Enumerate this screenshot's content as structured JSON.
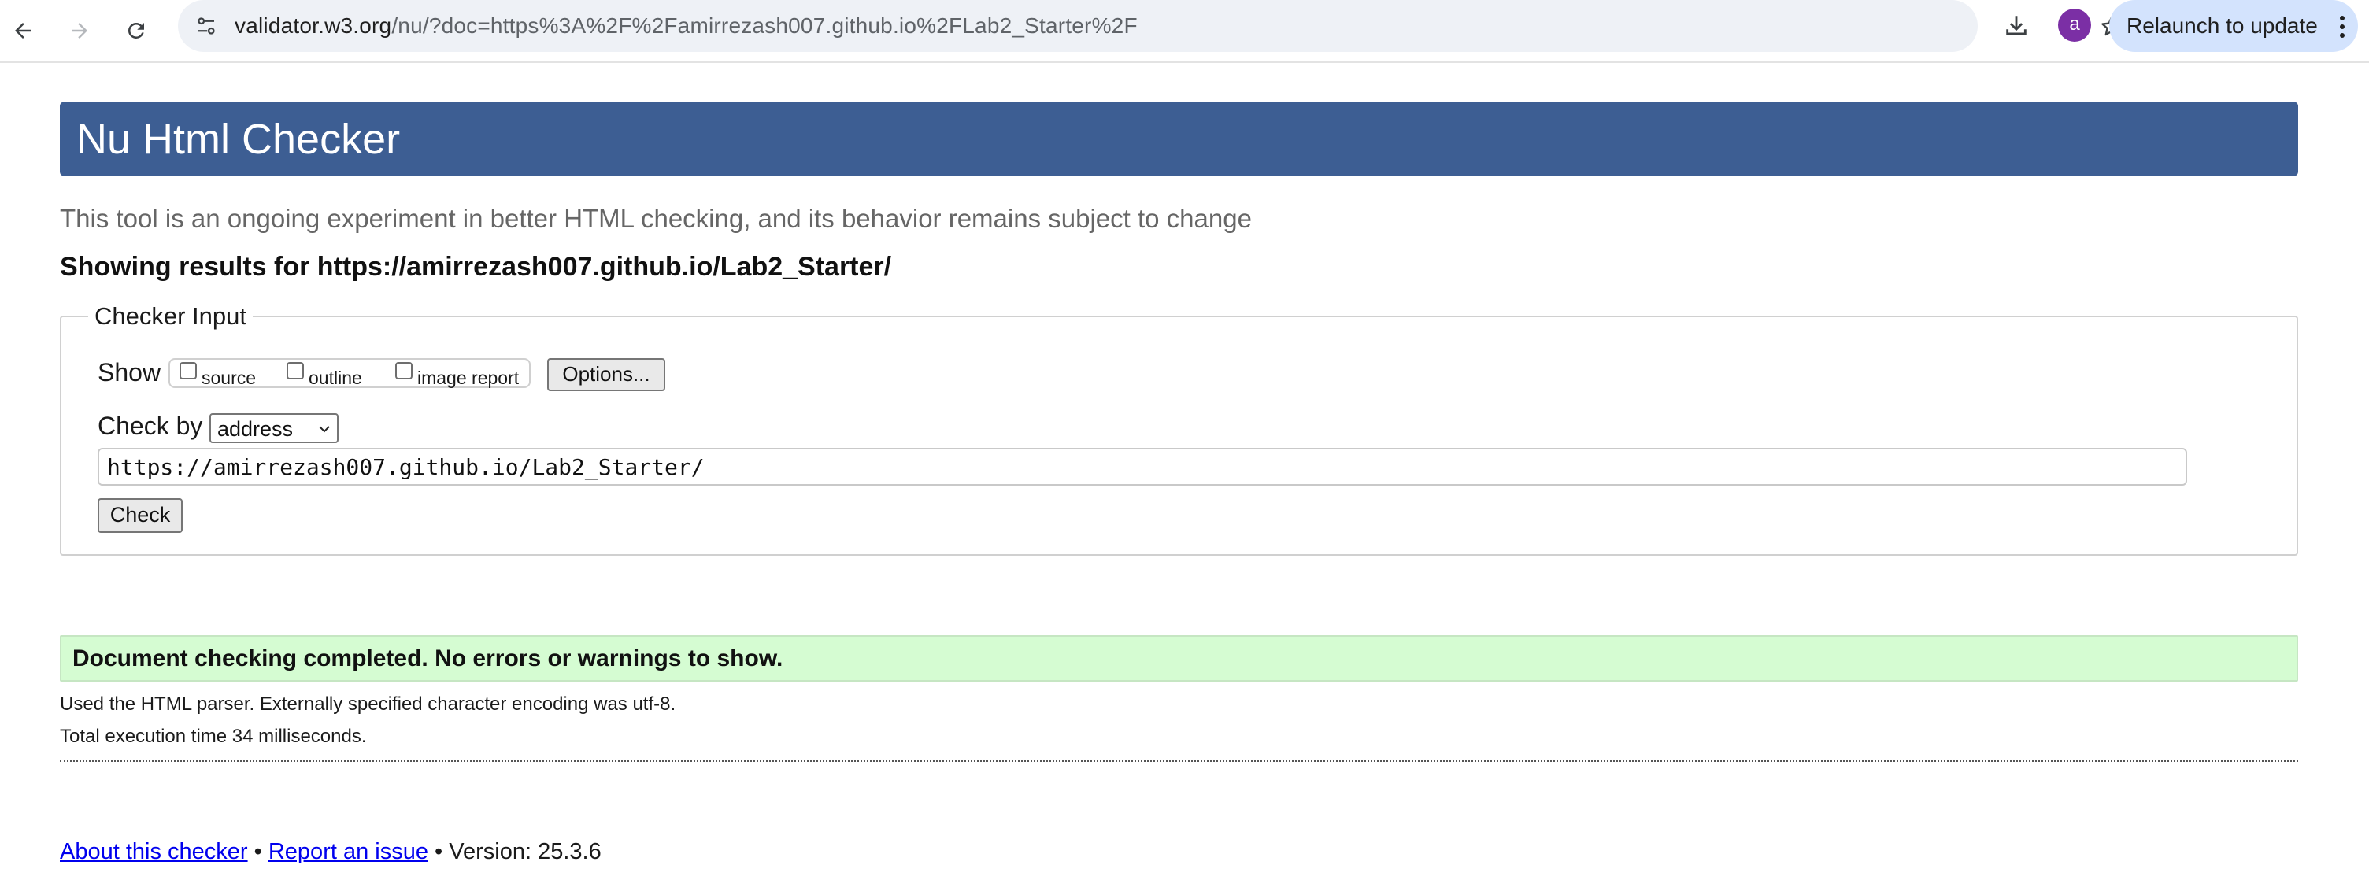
{
  "browser": {
    "url_host": "validator.w3.org",
    "url_rest": "/nu/?doc=https%3A%2F%2Famirrezash007.github.io%2FLab2_Starter%2F",
    "avatar_letter": "a",
    "relaunch_label": "Relaunch to update",
    "icons": [
      "back-arrow-icon",
      "forward-arrow-icon",
      "reload-icon",
      "site-info-icon",
      "bookmark-star-icon",
      "download-icon",
      "more-menu-icon"
    ]
  },
  "page": {
    "title": "Nu Html Checker",
    "tagline": "This tool is an ongoing experiment in better HTML checking, and its behavior remains subject to change",
    "showing_results": "Showing results for https://amirrezash007.github.io/Lab2_Starter/"
  },
  "checker_input": {
    "legend": "Checker Input",
    "show_label": "Show",
    "show_options": [
      {
        "label": "source",
        "checked": false
      },
      {
        "label": "outline",
        "checked": false
      },
      {
        "label": "image report",
        "checked": false
      }
    ],
    "options_button": "Options...",
    "check_by_label": "Check by",
    "check_by_value": "address",
    "url_value": "https://amirrezash007.github.io/Lab2_Starter/",
    "check_button": "Check"
  },
  "results": {
    "success_message": "Document checking completed. No errors or warnings to show.",
    "parser_info": "Used the HTML parser. Externally specified character encoding was utf-8.",
    "execution_time": "Total execution time 34 milliseconds."
  },
  "footer": {
    "about_link": "About this checker",
    "separator": " • ",
    "report_link": "Report an issue",
    "version": "Version: 25.3.6"
  },
  "colors": {
    "header_blue": "#3d5e93",
    "success_green": "#d5fcd2",
    "link_blue": "#0000ee",
    "avatar_purple": "#7b2fa5",
    "relaunch_blue": "#d3e3fd"
  }
}
